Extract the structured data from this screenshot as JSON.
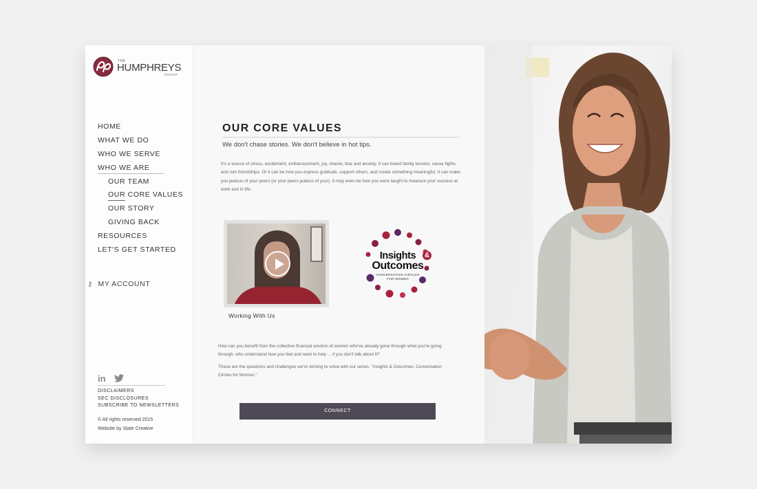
{
  "brand": {
    "the": "THE",
    "name": "HUMPHREYS",
    "group": "GROUP"
  },
  "nav": [
    {
      "label": "HOME"
    },
    {
      "label": "WHAT WE DO"
    },
    {
      "label": "WHO WE SERVE"
    },
    {
      "label": "WHO WE ARE"
    },
    {
      "label": "OUR TEAM"
    },
    {
      "label": "OUR CORE VALUES"
    },
    {
      "label": "OUR STORY"
    },
    {
      "label": "GIVING BACK"
    },
    {
      "label": "RESOURCES"
    },
    {
      "label": "LET'S GET STARTED"
    }
  ],
  "account": {
    "label": "MY ACCOUNT",
    "icon": "key-icon"
  },
  "social": {
    "linkedin": "in",
    "twitter_icon": "twitter-icon"
  },
  "footer": {
    "links": [
      "DISCLAIMERS",
      "SEC DISCLOSURES",
      "SUBSCRIBE TO NEWSLETTERS"
    ],
    "copyright": "© All rights reserved 2015",
    "credit": "Website by State Creative"
  },
  "main": {
    "title": "OUR CORE VALUES",
    "subtitle": "We don't chase stories. We don't believe in hot tips.",
    "body1": "It's a source of stress, excitement, embarrassment, joy, shame, fear and anxiety. It can breed family tension, cause fights and ruin friendships. Or it can be how you express gratitude, support others, and create something meaningful. It can make you jealous of your peers (or your peers jealous of you!). It may even be how you were taught to measure your success at work and in life.",
    "video_caption": "Working With Us",
    "io_logo": {
      "word1": "Insights",
      "amp": "&",
      "word2": "Outcomes",
      "tag1": "CONVERSATION CIRCLES",
      "tag2": "FOR WOMEN"
    },
    "body2": "How can you benefit from the collective financial wisdom of women who've already gone through what you're going through, who understand how you feel and want to help ... if you don't talk about it?",
    "body3": "These are the questions and challenges we're striving to solve with our series, \"Insights & Outcomes: Conversation Circles for Women.\"",
    "connect_label": "CONNECT"
  },
  "colors": {
    "brand_purple": "#4f4956",
    "accent_crimson": "#a8213d",
    "accent_plum": "#5b2a66"
  }
}
